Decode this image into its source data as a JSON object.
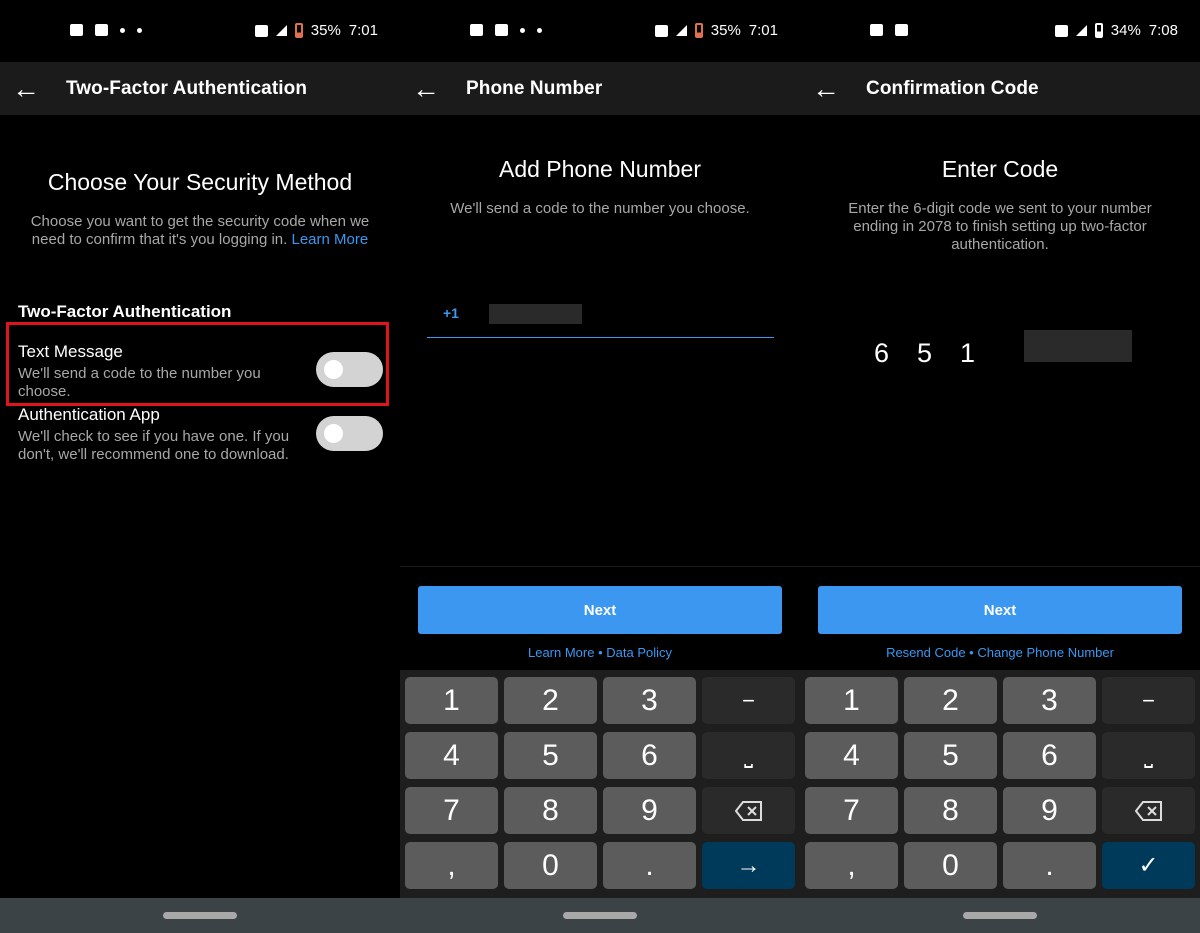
{
  "screens": [
    {
      "status": {
        "battery": "35%",
        "time": "7:01",
        "battery_low": true
      },
      "header": {
        "title": "Two-Factor Authentication"
      },
      "heading": "Choose Your Security Method",
      "description": "Choose you want to get the security code when we need to confirm that it's you logging in.",
      "learn_more": "Learn More",
      "section": "Two-Factor Authentication",
      "options": [
        {
          "title": "Text Message",
          "desc": "We'll send a code to the number you choose.",
          "enabled": false,
          "highlighted": true
        },
        {
          "title": "Authentication App",
          "desc": "We'll check to see if you have one. If you don't, we'll recommend one to download.",
          "enabled": false
        }
      ]
    },
    {
      "status": {
        "battery": "35%",
        "time": "7:01",
        "battery_low": true
      },
      "header": {
        "title": "Phone Number"
      },
      "heading": "Add Phone Number",
      "description": "We'll send a code to the number you choose.",
      "country_code": "+1",
      "next": "Next",
      "links": {
        "a": "Learn More",
        "sep": " • ",
        "b": "Data Policy"
      },
      "action_key": "→"
    },
    {
      "status": {
        "battery": "34%",
        "time": "7:08",
        "battery_low": false
      },
      "header": {
        "title": "Confirmation Code"
      },
      "heading": "Enter Code",
      "description": "Enter the 6-digit code we sent to your number ending in 2078 to finish setting up two-factor authentication.",
      "code_digits": [
        "6",
        "5",
        "1"
      ],
      "next": "Next",
      "links": {
        "a": "Resend Code",
        "sep": " • ",
        "b": "Change Phone Number"
      },
      "action_key": "✓"
    }
  ],
  "keyboard": {
    "rows": [
      [
        "1",
        "2",
        "3",
        "−"
      ],
      [
        "4",
        "5",
        "6",
        "␣"
      ],
      [
        "7",
        "8",
        "9",
        "⌫"
      ],
      [
        ",",
        "0",
        ".",
        "ACTION"
      ]
    ]
  },
  "colors": {
    "accent": "#3b97f0",
    "highlight": "#e0141a",
    "action_key": "#003a5a"
  }
}
